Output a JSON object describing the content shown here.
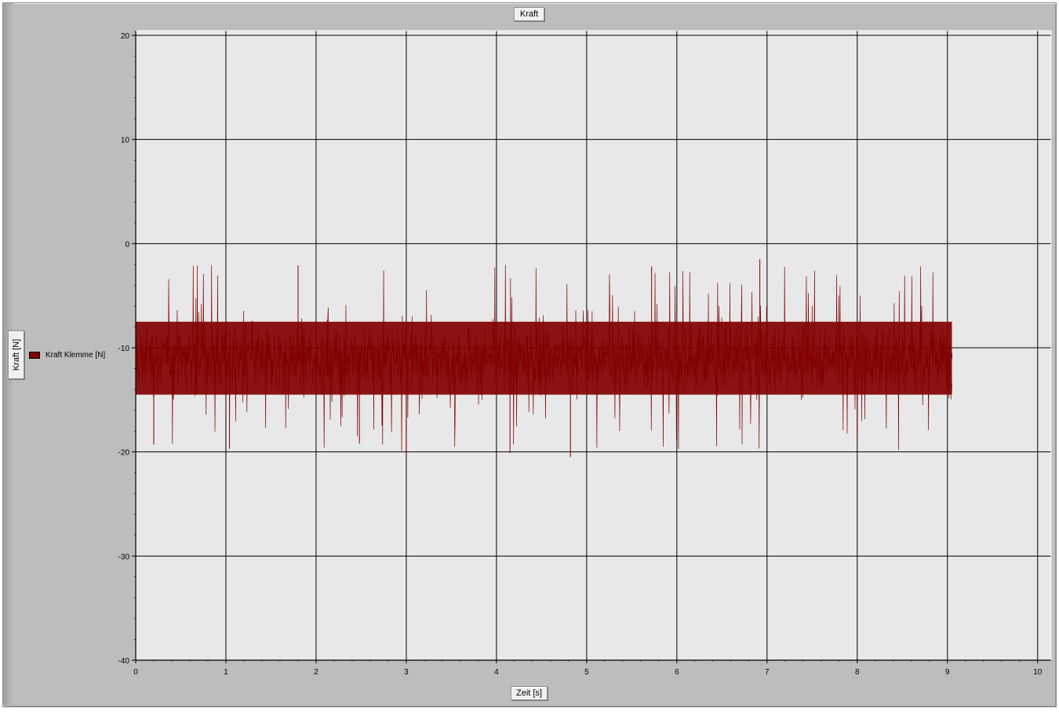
{
  "chart_data": {
    "type": "line",
    "title": "Kraft",
    "xlabel": "Zeit [s]",
    "ylabel": "Kraft [N]",
    "xlim": [
      0,
      10.15
    ],
    "ylim": [
      -40,
      20
    ],
    "xticks": [
      "0",
      "1",
      "2",
      "3",
      "4",
      "5",
      "6",
      "7",
      "8",
      "9",
      "10"
    ],
    "yticks": [
      "20",
      "10",
      "0",
      "-10",
      "-20",
      "-30",
      "-40"
    ],
    "xtick_values": [
      0,
      1,
      2,
      3,
      4,
      5,
      6,
      7,
      8,
      9,
      10
    ],
    "ytick_values": [
      20,
      10,
      0,
      -10,
      -20,
      -30,
      -40
    ],
    "grid": true,
    "legend_position": "left",
    "plot_background": "#e8e8e8",
    "series": [
      {
        "name": "Kraft Klemme [N]",
        "color": "#800000",
        "x_range": [
          0,
          9.05
        ],
        "mean": -11,
        "core_band": [
          -14.5,
          -7.5
        ],
        "spike_range": [
          -20.5,
          -1.5
        ],
        "description_points": [
          {
            "x": 0.0,
            "y": -3.5
          },
          {
            "x": 0.2,
            "y": -19.3
          },
          {
            "x": 1.04,
            "y": -19.7
          },
          {
            "x": 1.8,
            "y": -2.1
          },
          {
            "x": 2.48,
            "y": -19.2
          },
          {
            "x": 3.0,
            "y": -20.3
          },
          {
            "x": 4.15,
            "y": -20.1
          },
          {
            "x": 4.82,
            "y": -20.5
          },
          {
            "x": 5.72,
            "y": -2.2
          },
          {
            "x": 6.92,
            "y": -1.5
          },
          {
            "x": 8.0,
            "y": -18.6
          },
          {
            "x": 9.05,
            "y": -10.5
          }
        ]
      }
    ]
  }
}
